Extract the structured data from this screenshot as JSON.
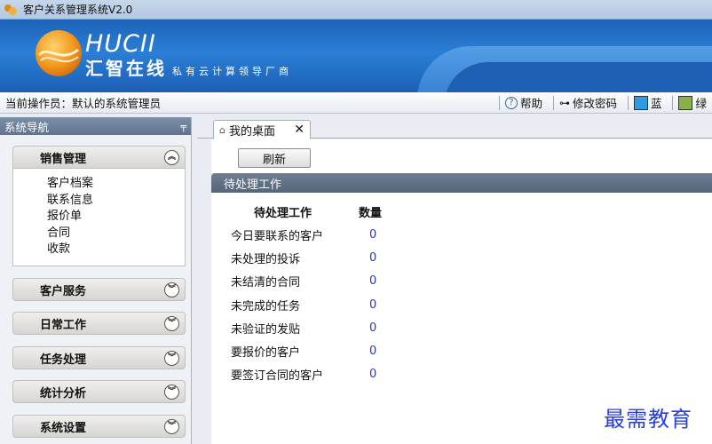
{
  "window": {
    "title": "客户关系管理系统V2.0"
  },
  "banner": {
    "logo_en": "HUCII",
    "logo_cn": "汇智在线",
    "slogan": "私有云计算领导厂商"
  },
  "statusbar": {
    "operator": "当前操作员：默认的系统管理员",
    "help": "帮助",
    "change_password": "修改密码",
    "theme_blue": "蓝",
    "theme_green": "绿",
    "colors": {
      "blue": "#2f9be0",
      "green": "#8bb04a"
    }
  },
  "sidebar": {
    "title": "系统导航",
    "groups": [
      {
        "label": "销售管理",
        "expanded": true,
        "items": [
          "客户档案",
          "联系信息",
          "报价单",
          "合同",
          "收款"
        ]
      },
      {
        "label": "客户服务",
        "expanded": false
      },
      {
        "label": "日常工作",
        "expanded": false
      },
      {
        "label": "任务处理",
        "expanded": false
      },
      {
        "label": "统计分析",
        "expanded": false
      },
      {
        "label": "系统设置",
        "expanded": false
      }
    ]
  },
  "main": {
    "tab_label": "我的桌面",
    "refresh_label": "刷新",
    "section_title": "待处理工作",
    "columns": [
      "待处理工作",
      "数量"
    ],
    "rows": [
      {
        "name": "今日要联系的客户",
        "count": "0"
      },
      {
        "name": "未处理的投诉",
        "count": "0"
      },
      {
        "name": "未结清的合同",
        "count": "0"
      },
      {
        "name": "未完成的任务",
        "count": "0"
      },
      {
        "name": "未验证的发贴",
        "count": "0"
      },
      {
        "name": "要报价的客户",
        "count": "0"
      },
      {
        "name": "要签订合同的客户",
        "count": "0"
      }
    ]
  },
  "watermark": "最需教育"
}
